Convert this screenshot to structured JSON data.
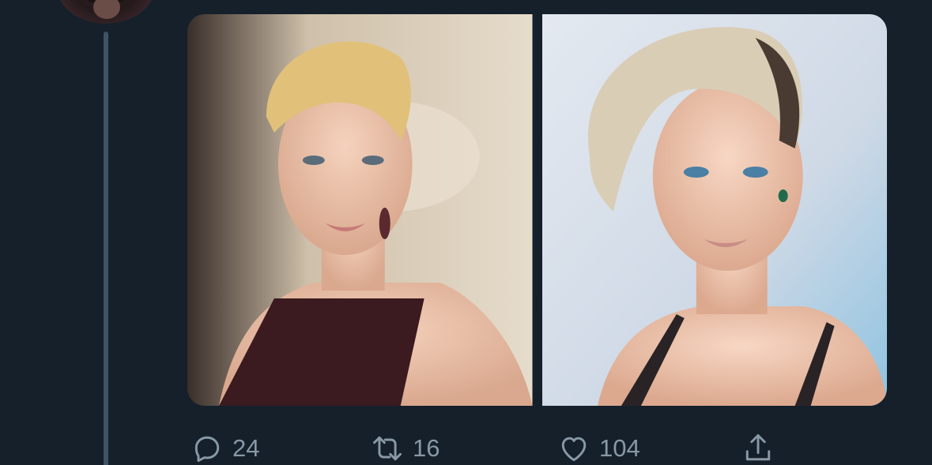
{
  "theme": {
    "background": "#15202b",
    "muted_text": "#8899a6",
    "thread_line": "#3d5466"
  },
  "tweet": {
    "author_avatar_icon": "avatar",
    "media": [
      {
        "icon": "photo-1"
      },
      {
        "icon": "photo-2"
      }
    ],
    "actions": {
      "reply_count": "24",
      "retweet_count": "16",
      "like_count": "104",
      "share_icon": "share-icon"
    }
  }
}
